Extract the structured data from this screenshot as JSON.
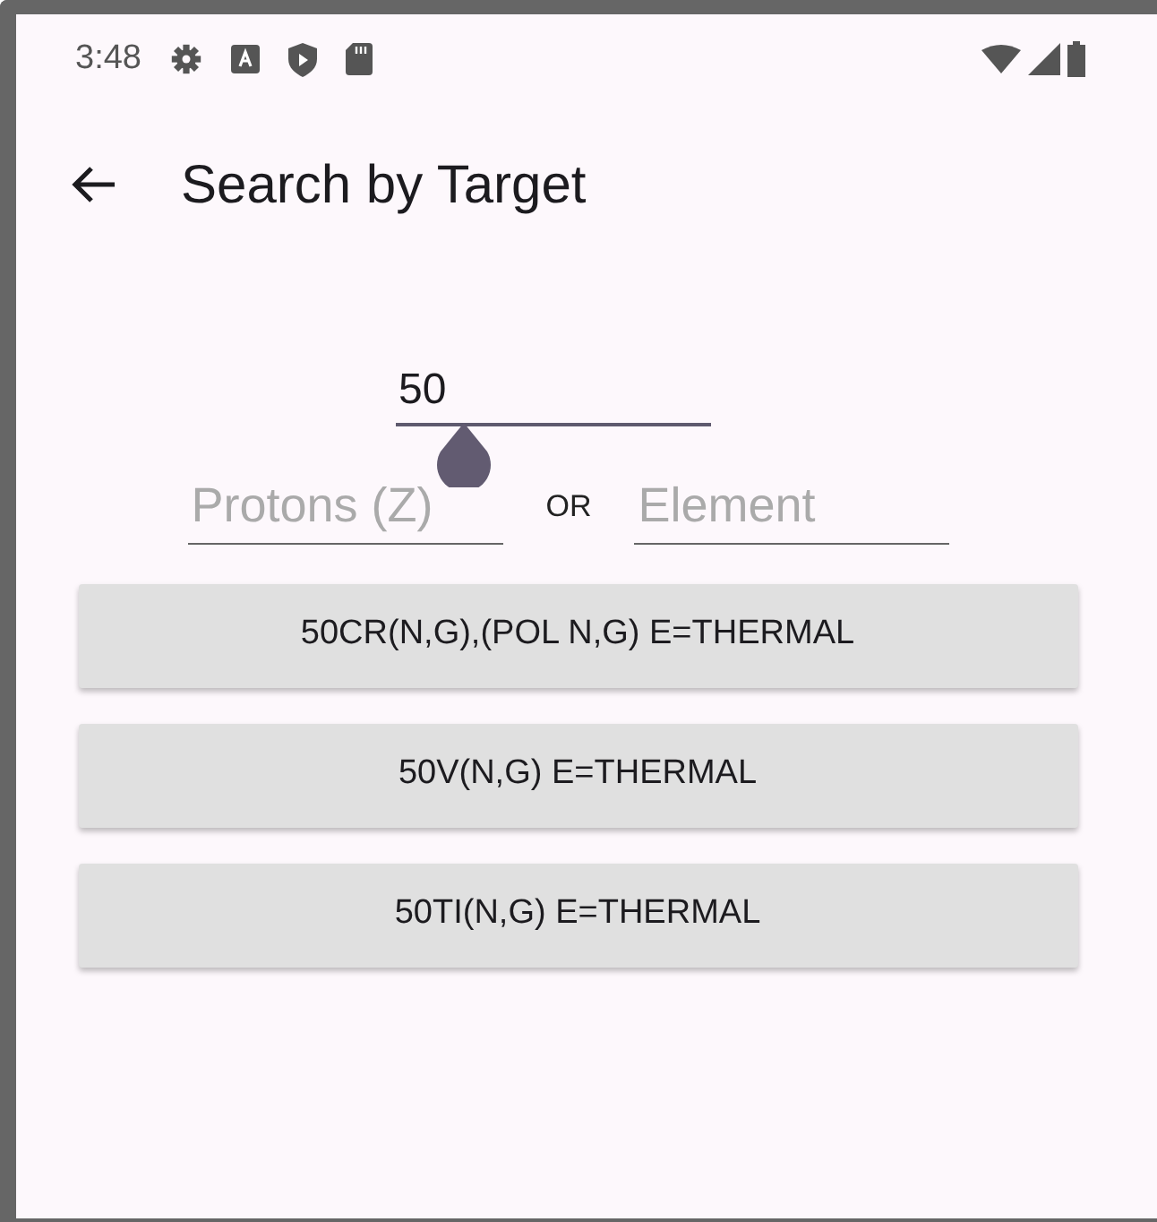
{
  "status_bar": {
    "time": "3:48"
  },
  "app_bar": {
    "title": "Search by Target"
  },
  "mass_field": {
    "value": "50"
  },
  "protons_field": {
    "placeholder": "Protons (Z)"
  },
  "separator": "OR",
  "element_field": {
    "placeholder": "Element"
  },
  "results": [
    {
      "label": "50CR(N,G),(POL N,G) E=THERMAL"
    },
    {
      "label": "50V(N,G) E=THERMAL"
    },
    {
      "label": "50TI(N,G) E=THERMAL"
    }
  ]
}
